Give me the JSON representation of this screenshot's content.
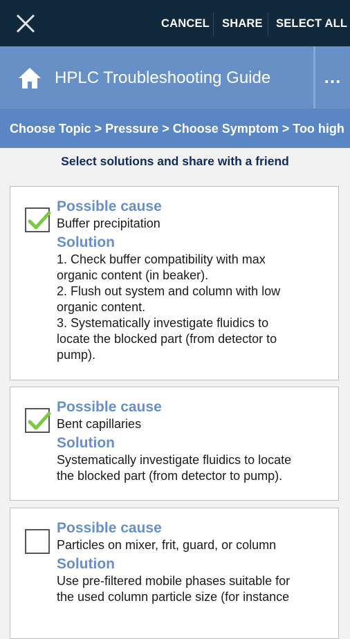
{
  "actionbar": {
    "close_icon": "close-x-icon",
    "cancel": "CANCEL",
    "share": "SHARE",
    "select_all": "SELECT ALL"
  },
  "header": {
    "home_icon": "home-icon",
    "title": "HPLC Troubleshooting Guide",
    "more": "..."
  },
  "breadcrumb": "Choose Topic > Pressure > Choose Symptom > Too high",
  "instruction": "Select solutions and share with a friend",
  "items": [
    {
      "cause_label": "Possible cause",
      "cause": "Buffer precipitation",
      "solution_label": "Solution",
      "solution_lines": [
        "1. Check buffer compatibility with max",
        "organic content (in beaker).",
        "2. Flush out system and column with low",
        "organic content.",
        "3. Systematically investigate fluidics to",
        "locate the blocked part (from detector to",
        "pump)."
      ],
      "checked": true
    },
    {
      "cause_label": "Possible cause",
      "cause": "Bent capillaries",
      "solution_label": "Solution",
      "solution_lines": [
        "Systematically investigate fluidics to locate",
        "the blocked part (from detector to pump)."
      ],
      "checked": true
    },
    {
      "cause_label": "Possible cause",
      "cause": "Particles on mixer, frit, guard, or column",
      "solution_label": "Solution",
      "solution_lines": [
        "Use pre-filtered mobile phases suitable for",
        "the used column particle size (for instance"
      ],
      "checked": false
    }
  ],
  "colors": {
    "actionbar_bg": "#10293d",
    "header_bg": "#6790c7",
    "breadcrumb_bg": "#5b86c4",
    "heading_blue": "#6790c7",
    "instruction_navy": "#102a5c",
    "check_green": "#7bc943"
  }
}
